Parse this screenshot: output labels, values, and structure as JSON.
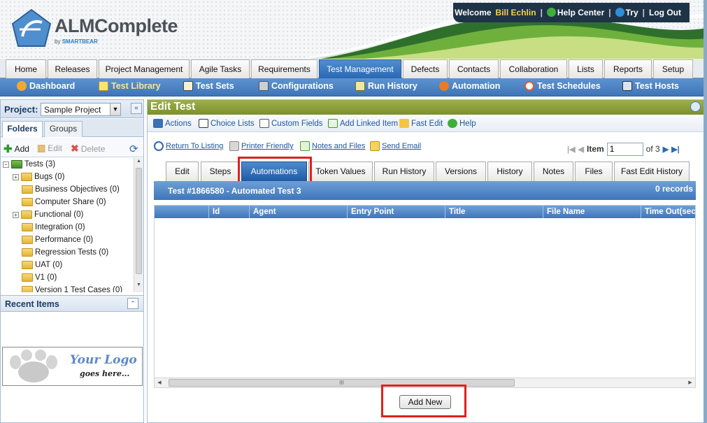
{
  "header": {
    "brand": "ALMComplete",
    "brand_by": "by",
    "brand_company": "SMARTBEAR",
    "welcome": "Welcome",
    "user_name": "Bill Echlin",
    "help_center": "Help Center",
    "try": "Try",
    "logout": "Log Out"
  },
  "main_tabs": [
    "Home",
    "Releases",
    "Project Management",
    "Agile Tasks",
    "Requirements",
    "Test Management",
    "Defects",
    "Contacts",
    "Collaboration",
    "Lists",
    "Reports",
    "Setup"
  ],
  "active_main_tab": "Test Management",
  "sub_nav": [
    {
      "label": "Dashboard",
      "icon": "dashboard-icon"
    },
    {
      "label": "Test Library",
      "icon": "test-library-icon"
    },
    {
      "label": "Test Sets",
      "icon": "test-sets-icon"
    },
    {
      "label": "Configurations",
      "icon": "configurations-icon"
    },
    {
      "label": "Run History",
      "icon": "run-history-icon"
    },
    {
      "label": "Automation",
      "icon": "automation-icon"
    },
    {
      "label": "Test Schedules",
      "icon": "test-schedules-icon"
    },
    {
      "label": "Test Hosts",
      "icon": "test-hosts-icon"
    }
  ],
  "active_sub_nav": "Test Library",
  "left_panel": {
    "project_label": "Project:",
    "project_value": "Sample Project",
    "tabs": [
      "Folders",
      "Groups"
    ],
    "tools": {
      "add": "Add",
      "edit": "Edit",
      "delete": "Delete"
    },
    "tree": [
      {
        "label": "Tests (3)",
        "level": 0,
        "expander": "−"
      },
      {
        "label": "Bugs (0)",
        "level": 1,
        "expander": "+"
      },
      {
        "label": "Business Objectives (0)",
        "level": 1,
        "expander": ""
      },
      {
        "label": "Computer Share (0)",
        "level": 1,
        "expander": ""
      },
      {
        "label": "Functional (0)",
        "level": 1,
        "expander": "+"
      },
      {
        "label": "Integration (0)",
        "level": 1,
        "expander": ""
      },
      {
        "label": "Performance (0)",
        "level": 1,
        "expander": ""
      },
      {
        "label": "Regression Tests (0)",
        "level": 1,
        "expander": ""
      },
      {
        "label": "UAT (0)",
        "level": 1,
        "expander": ""
      },
      {
        "label": "V1 (0)",
        "level": 1,
        "expander": ""
      },
      {
        "label": "Version 1 Test Cases (0)",
        "level": 1,
        "expander": ""
      }
    ],
    "recent_items": "Recent Items",
    "logo_line1": "Your Logo",
    "logo_line2": "goes here..."
  },
  "edit": {
    "title": "Edit Test",
    "actions": [
      "Actions",
      "Choice Lists",
      "Custom Fields",
      "Add Linked Item",
      "Fast Edit",
      "Help"
    ],
    "links": [
      "Return To Listing",
      "Printer Friendly",
      "Notes and Files",
      "Send Email"
    ],
    "pager": {
      "label": "Item",
      "value": "1",
      "of": "of 3"
    },
    "tabs": [
      "Edit",
      "Steps",
      "Automations",
      "Token Values",
      "Run History",
      "Versions",
      "History",
      "Notes",
      "Files",
      "Fast Edit History"
    ],
    "active_tab": "Automations",
    "test_title": "Test #1866580 - Automated Test 3",
    "records": "0 records",
    "columns": [
      "",
      "Id",
      "Agent",
      "Entry Point",
      "Title",
      "File Name",
      "Time Out(sec"
    ],
    "rows": [],
    "add_new": "Add New"
  },
  "colors": {
    "accent_blue": "#3e76bb",
    "active_tab": "#2a68b3",
    "header_green": "#8a9f36",
    "highlight_red": "#e02020",
    "user_name_yellow": "#f6d04d"
  }
}
